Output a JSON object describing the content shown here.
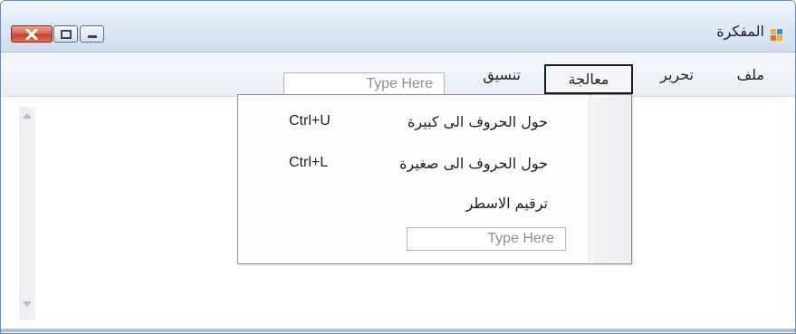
{
  "window": {
    "title": "المفكرة",
    "icon": "app-icon",
    "controls": {
      "close": "close-icon",
      "maximize": "maximize-icon",
      "minimize": "minimize-icon"
    }
  },
  "menubar": {
    "items": [
      {
        "label": "ملف"
      },
      {
        "label": "تحرير"
      },
      {
        "label": "معالجة",
        "active": true
      },
      {
        "label": "تنسيق"
      }
    ],
    "new_item_placeholder": "Type Here"
  },
  "dropdown": {
    "items": [
      {
        "label": "حول الحروف الى كبيرة",
        "shortcut": "Ctrl+U"
      },
      {
        "label": "حول الحروف الى صغيرة",
        "shortcut": "Ctrl+L"
      },
      {
        "label": "ترقيم الاسطر",
        "shortcut": ""
      }
    ],
    "new_item_placeholder": "Type Here"
  },
  "colors": {
    "title_gradient_top": "#f1f6fb",
    "title_gradient_bottom": "#cfdeee",
    "close_button": "#c1422a",
    "accent_border": "#6f8aa8"
  }
}
